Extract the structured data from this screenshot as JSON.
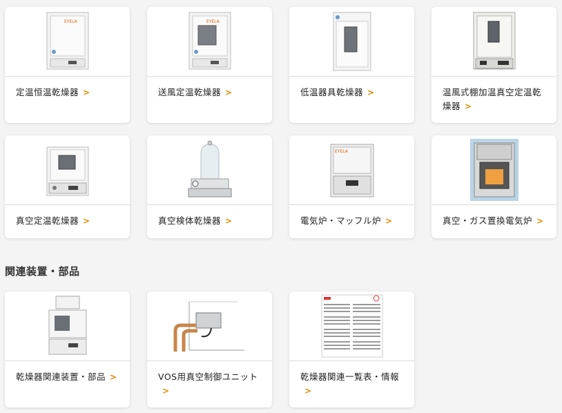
{
  "products": [
    {
      "label": "定温恒温乾燥器",
      "icon": "oven-icon"
    },
    {
      "label": "送風定温乾燥器",
      "icon": "oven-window-icon"
    },
    {
      "label": "低温器具乾燥器",
      "icon": "tall-oven-icon"
    },
    {
      "label": "温風式棚加温真空定温乾燥器",
      "icon": "vacuum-oven-icon"
    },
    {
      "label": "真空定温乾燥器",
      "icon": "vacuum-dryer-icon"
    },
    {
      "label": "真空検体乾燥器",
      "icon": "bell-jar-icon"
    },
    {
      "label": "電気炉・マッフル炉",
      "icon": "muffle-furnace-icon"
    },
    {
      "label": "真空・ガス置換電気炉",
      "icon": "gas-furnace-icon"
    }
  ],
  "related_section": {
    "title": "関連装置・部品",
    "items": [
      {
        "label": "乾燥器関連装置・部品",
        "icon": "stacked-dryer-icon"
      },
      {
        "label": "VOS用真空制御ユニット",
        "icon": "vacuum-control-unit-icon"
      },
      {
        "label": "乾燥器関連一覧表・情報",
        "icon": "document-icon"
      }
    ]
  },
  "arrow_glyph": ">",
  "colors": {
    "accent": "#e08a00",
    "background": "#f4f4f4",
    "card": "#ffffff"
  }
}
